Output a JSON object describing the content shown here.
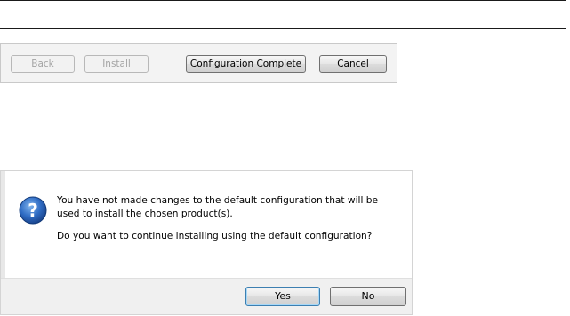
{
  "wizard": {
    "back_label": "Back",
    "install_label": "Install",
    "configuration_complete_label": "Configuration Complete",
    "cancel_label": "Cancel"
  },
  "dialog": {
    "icon": "question-icon",
    "message_line": "You have not made changes to the default configuration that will be used to install the chosen product(s).",
    "question": "Do you want to continue installing using the default configuration?",
    "yes_label": "Yes",
    "no_label": "No"
  },
  "colors": {
    "icon_blue": "#2a5fb3",
    "default_button_border": "#3c7fb1"
  }
}
